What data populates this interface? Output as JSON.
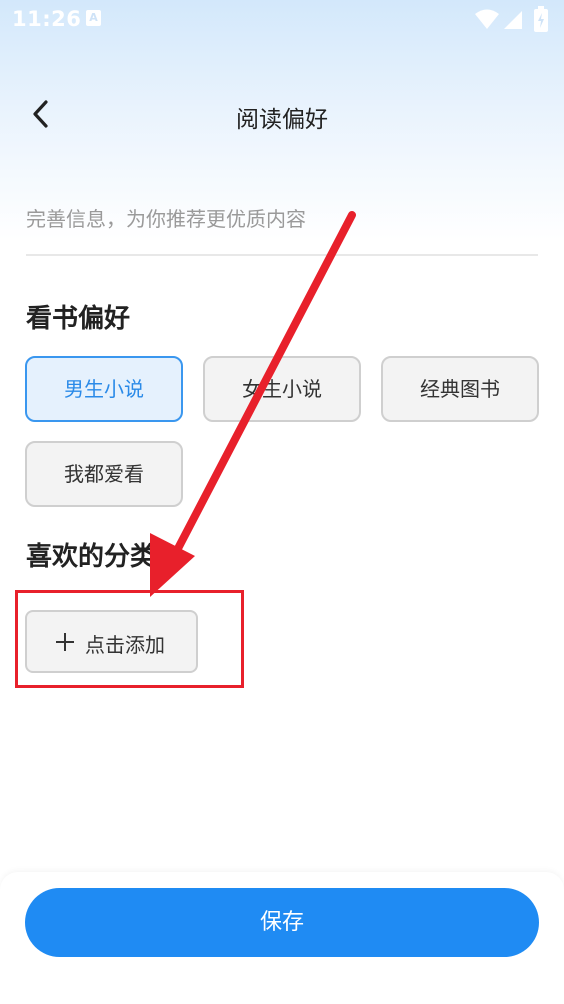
{
  "status_bar": {
    "time": "11:26",
    "notification_badge": "A",
    "icons": [
      "wifi-icon",
      "signal-icon",
      "battery-icon"
    ]
  },
  "header": {
    "title": "阅读偏好",
    "back_icon": "chevron-left-icon"
  },
  "hint": {
    "text": "完善信息，为你推荐更优质内容"
  },
  "reading_preference": {
    "title": "看书偏好",
    "options": [
      {
        "label": "男生小说",
        "selected": true
      },
      {
        "label": "女生小说",
        "selected": false
      },
      {
        "label": "经典图书",
        "selected": false
      },
      {
        "label": "我都爱看",
        "selected": false
      }
    ]
  },
  "favorite_categories": {
    "title": "喜欢的分类",
    "add_label": "点击添加",
    "add_icon": "plus-icon"
  },
  "footer": {
    "save_label": "保存"
  },
  "colors": {
    "accent": "#1f8bf3",
    "selected_border": "#3a97ef",
    "selected_bg": "#e5f1fd",
    "annotation_red": "#e8202b"
  }
}
